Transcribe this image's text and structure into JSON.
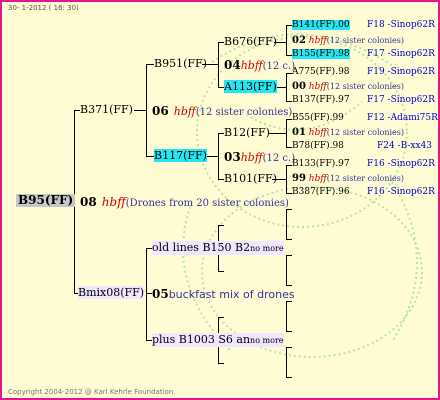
{
  "header": {
    "date": "30- 1-2012 ( 16: 30)"
  },
  "footer": {
    "copyright": "Copyright 2004-2012 @ Karl Kehrle Foundation."
  },
  "root": {
    "label": "B95(FF)",
    "gen_num": "08",
    "mating": "hbff",
    "mating_note": "(Drones from 20 sister colonies)"
  },
  "dam": {
    "label": "B371(FF)",
    "gen_num": "06",
    "mating": "hbff",
    "mating_note": "(12 sister colonies)"
  },
  "granddam_a": {
    "label": "B951(FF)",
    "gen_num": "04",
    "mating": "hbff",
    "mating_note": "(12 c.)"
  },
  "granddam_b": {
    "label": "B117(FF)",
    "gen_num": "03",
    "mating": "hbff",
    "mating_note": "(12 c.)"
  },
  "gg": {
    "b676": "B676(FF)",
    "a113": "A113(FF)",
    "b12": "B12(FF)",
    "b101": "B101(FF)"
  },
  "leaves": [
    {
      "name": "B141(FF)",
      "score": ".00",
      "ref": "F18 -Sinop62R",
      "hl": true
    },
    {
      "num": "02",
      "mating": "hbff",
      "note": "(12 sister colonies)"
    },
    {
      "name": "B155(FF)",
      "score": ".98",
      "ref": "F17 -Sinop62R",
      "hl": true
    },
    {
      "name": "A775(FF)",
      "score": ".98",
      "ref": "F19 -Sinop62R"
    },
    {
      "num": "00",
      "mating": "hbff",
      "note": "(12 sister colonies)"
    },
    {
      "name": "B137(FF)",
      "score": ".97",
      "ref": "F17 -Sinop62R"
    },
    {
      "name": "B55(FF)",
      "score": ".99",
      "ref": "F12 -Adami75R"
    },
    {
      "num": "01",
      "mating": "hbff",
      "note": "(12 sister colonies)"
    },
    {
      "name": "B78(FF)",
      "score": ".98",
      "ref": "F24 -B-xx43"
    },
    {
      "name": "B133(FF)",
      "score": ".97",
      "ref": "F16 -Sinop62R"
    },
    {
      "num": "99",
      "mating": "hbff",
      "note": "(12 sister colonies)"
    },
    {
      "name": "B387(FF)",
      "score": ".96",
      "ref": "F16 -Sinop62R"
    }
  ],
  "sire": {
    "label": "Bmix08(FF)",
    "gen_num": "05",
    "desc": "buckfast mix of drones",
    "old_lines": "old lines B150 B2",
    "old_more": "no more",
    "plus": "plus B1003 S6 an",
    "plus_more": "no more"
  }
}
